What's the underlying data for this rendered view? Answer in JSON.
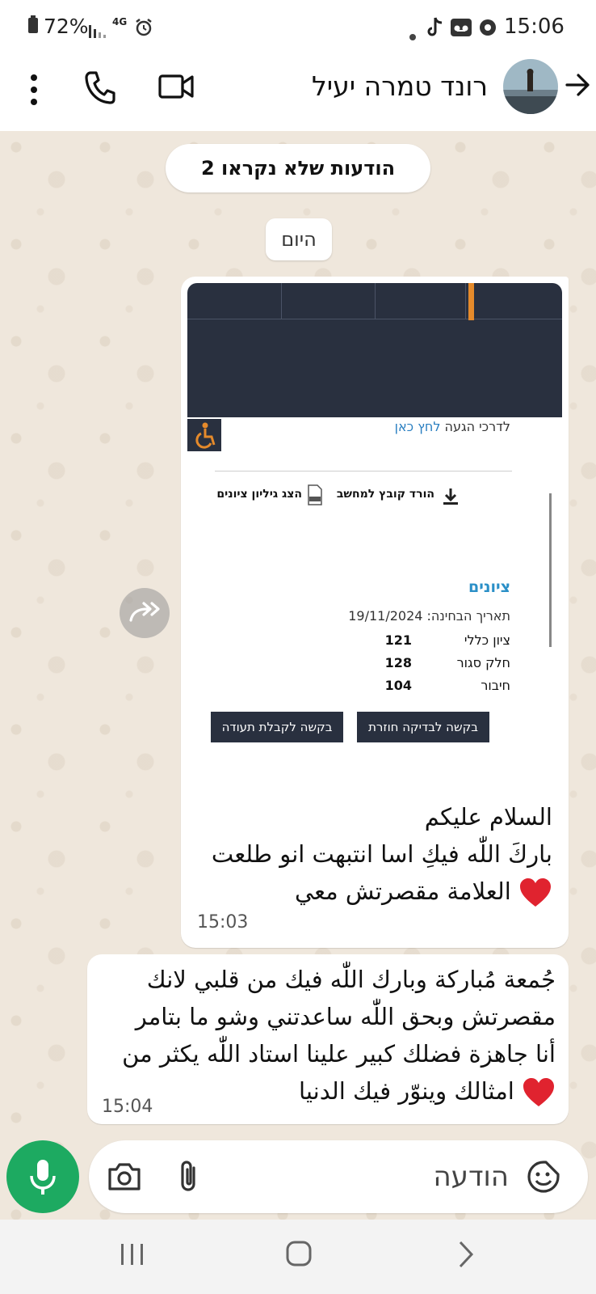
{
  "status_bar": {
    "battery": "72%",
    "network": "4G",
    "time": "15:06"
  },
  "header": {
    "contact_name": "רונד טמרה יעיל"
  },
  "unread_banner": "2 הודעות שלא נקראו",
  "date_chip": "היום",
  "screenshot_message": {
    "arrival_text": "לדרכי הגעה",
    "arrival_link": "לחץ כאן",
    "download_label": "הורד קובץ למחשב",
    "sheet_label": "הצג גיליון ציונים",
    "grades_title": "ציונים",
    "exam_date": "תאריך הבחינה: 19/11/2024",
    "grades": [
      {
        "label": "ציון כללי",
        "value": "121"
      },
      {
        "label": "חלק סגור",
        "value": "128"
      },
      {
        "label": "חיבור",
        "value": "104"
      }
    ],
    "button_recheck": "בקשה לבדיקה חוזרת",
    "button_certificate": "בקשה לקבלת תעודה"
  },
  "messages": [
    {
      "lines": [
        "السلام عليكم",
        "باركَ اللّٰه فيكِ اسا انتبهت انو طلعت",
        "العلامة مقصرتش معي"
      ],
      "time": "15:03"
    },
    {
      "lines": [
        "جُمعة مُباركة وبارك اللّٰه فيك من قلبي لانك",
        "مقصرتش وبحق اللّٰه ساعدتني وشو ما بتامر",
        "أنا جاهزة فضلك كبير علينا استاد اللّٰه يكثر من",
        "امثالك وينوّر فيك الدنيا"
      ],
      "time": "15:04"
    }
  ],
  "composer": {
    "placeholder": "הודעה"
  },
  "colors": {
    "accent_green": "#1daa61",
    "dark_navy": "#29303f",
    "link_blue": "#2a7fc1",
    "accessibility_orange": "#e58a2b"
  }
}
